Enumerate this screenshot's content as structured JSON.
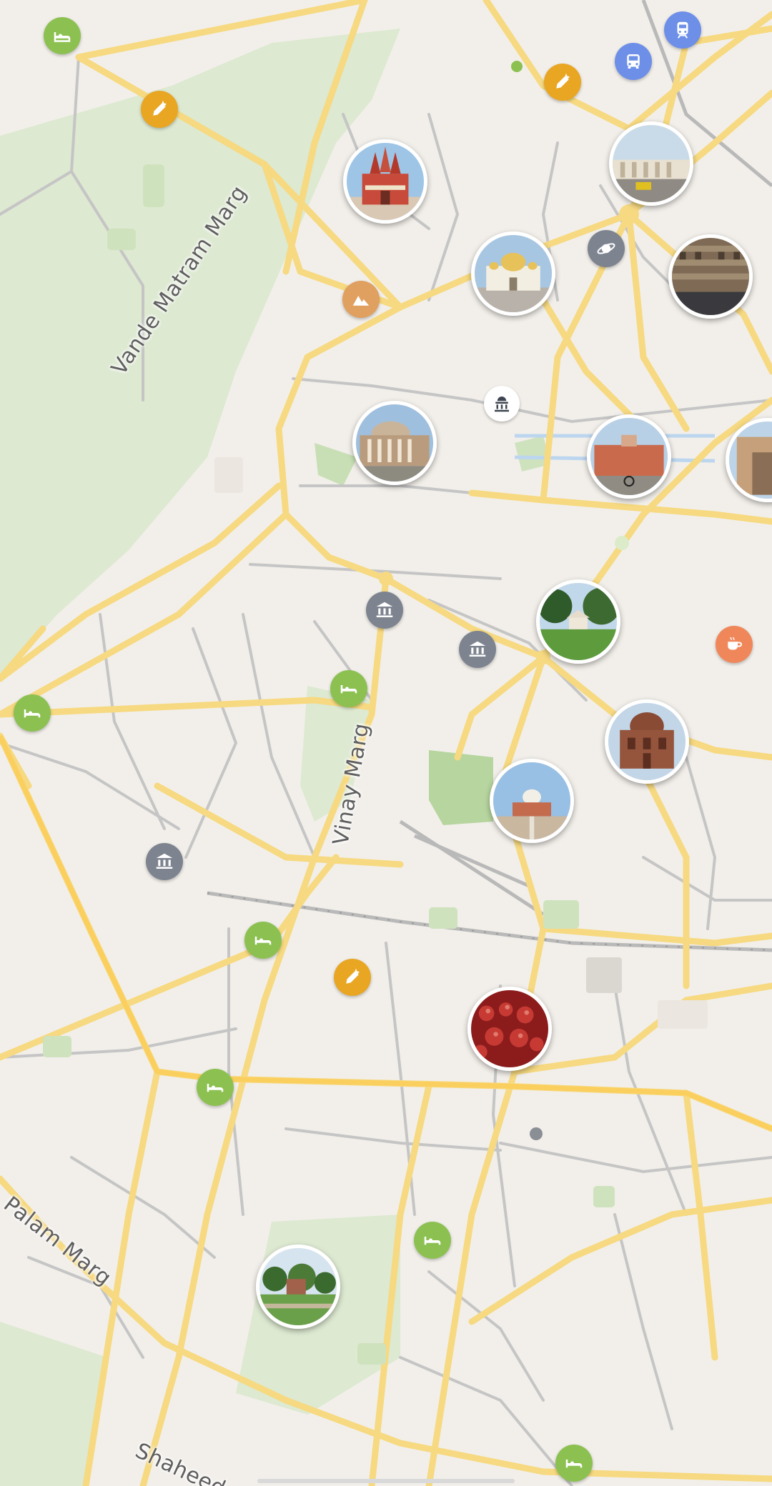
{
  "map": {
    "street_labels": [
      {
        "id": "vande-matram-marg",
        "text": "Vande Matram Marg"
      },
      {
        "id": "vinay-marg",
        "text": "Vinay Marg"
      },
      {
        "id": "palam-marg",
        "text": "Palam Marg"
      },
      {
        "id": "shaheed",
        "text": "Shaheed"
      }
    ],
    "colors": {
      "hotel": "#8cc152",
      "food": "#e8a623",
      "transit": "#6d8fe8",
      "museum": "#7d8490",
      "cafe": "#f0875a",
      "mountain": "#e0a060",
      "park": "#dbe8cf",
      "road_major": "#f8dd85",
      "road_minor": "#c9c9c9"
    },
    "pois": [
      {
        "category": "hotel",
        "icon": "bed-icon"
      },
      {
        "category": "food",
        "icon": "carrot-icon"
      },
      {
        "category": "transit",
        "icon": "bus-icon"
      },
      {
        "category": "transit",
        "icon": "train-icon"
      },
      {
        "category": "museum",
        "icon": "museum-icon"
      },
      {
        "category": "cafe",
        "icon": "coffee-cup-icon"
      },
      {
        "category": "mountain",
        "icon": "mountain-icon"
      },
      {
        "category": "planetarium",
        "icon": "planet-icon"
      },
      {
        "category": "monument",
        "icon": "parliament-icon"
      }
    ],
    "photo_markers": [
      "temple-photo",
      "connaught-place-photo",
      "gurudwara-photo",
      "stepwell-photo",
      "national-museum-photo",
      "red-building-photo",
      "india-gate-photo",
      "lodhi-gazebo-photo",
      "lodhi-tomb-photo",
      "humayun-tomb-photo",
      "market-pottery-photo",
      "mughal-garden-photo"
    ]
  }
}
